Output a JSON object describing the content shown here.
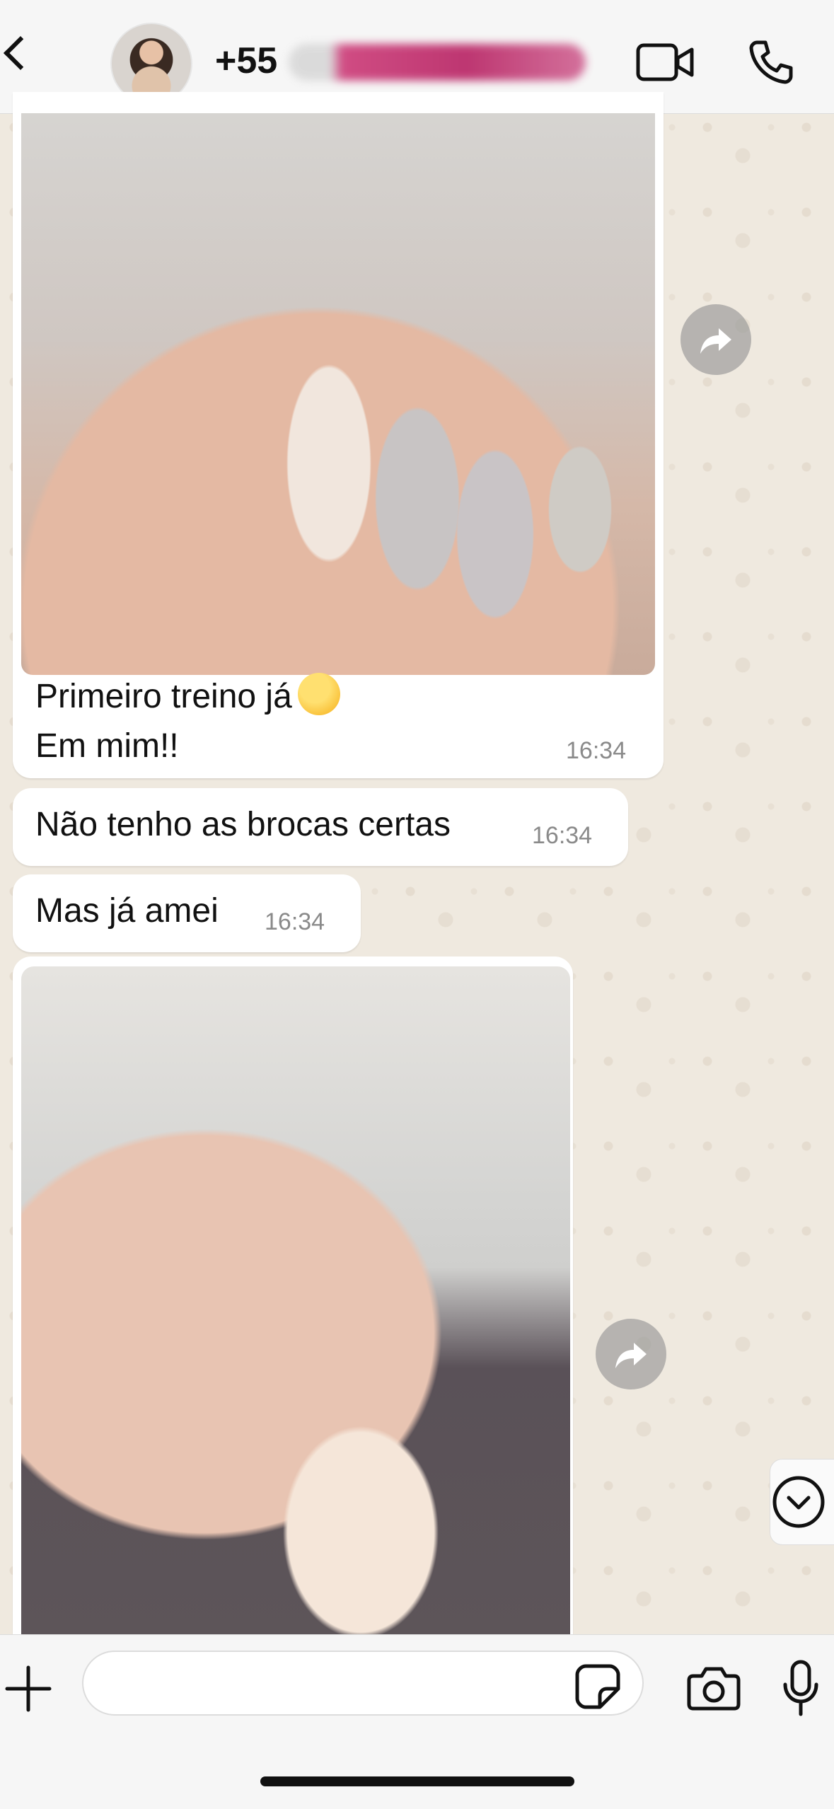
{
  "header": {
    "contact_prefix": "+55",
    "icons": {
      "back": "chevron-left-icon",
      "video": "video-camera-icon",
      "call": "phone-icon"
    }
  },
  "messages": [
    {
      "type": "image_with_caption",
      "caption_line1": "Primeiro treino já",
      "caption_line2": "Em mim!!",
      "emoji": "face-with-hand-over-mouth",
      "time": "16:34"
    },
    {
      "type": "text",
      "text": "Não tenho as brocas certas",
      "time": "16:34"
    },
    {
      "type": "text",
      "text": "Mas já amei",
      "time": "16:34"
    },
    {
      "type": "image"
    }
  ],
  "composer": {
    "placeholder": "",
    "icons": {
      "attach": "plus-icon",
      "sticker": "sticker-icon",
      "camera": "camera-icon",
      "mic": "microphone-icon"
    }
  },
  "colors": {
    "wallpaper": "#efe9df",
    "bubble": "#ffffff",
    "timestamp": "#8a8a8a"
  }
}
